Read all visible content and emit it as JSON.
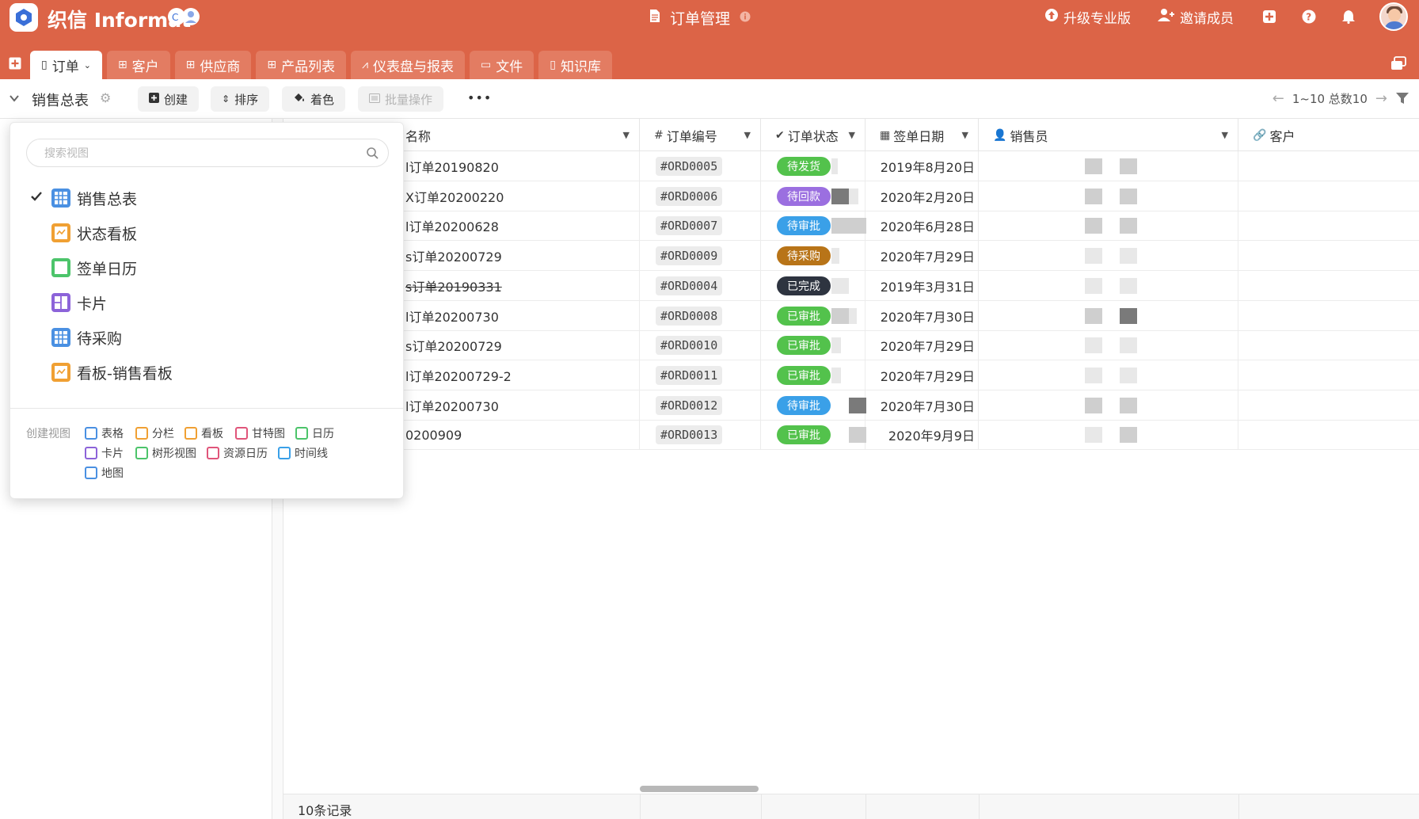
{
  "header": {
    "brand": "织信 Informat",
    "page_title": "订单管理",
    "actions": {
      "upgrade": "升级专业版",
      "invite": "邀请成员"
    }
  },
  "tabs": [
    {
      "label": "订单",
      "icon": "doc-icon"
    },
    {
      "label": "客户",
      "icon": "table-icon"
    },
    {
      "label": "供应商",
      "icon": "table-icon"
    },
    {
      "label": "产品列表",
      "icon": "table-icon"
    },
    {
      "label": "仪表盘与报表",
      "icon": "chart-icon"
    },
    {
      "label": "文件",
      "icon": "folder-icon"
    },
    {
      "label": "知识库",
      "icon": "doc-icon"
    }
  ],
  "toolbar": {
    "view_name": "销售总表",
    "create": "创建",
    "sort": "排序",
    "color": "着色",
    "batch": "批量操作",
    "more": "•••",
    "pager": "1~10 总数10"
  },
  "dropdown": {
    "search_placeholder": "搜索视图",
    "views": [
      {
        "label": "销售总表",
        "icon": "table-view-icon",
        "selected": true
      },
      {
        "label": "状态看板",
        "icon": "kanban-view-icon",
        "selected": false
      },
      {
        "label": "签单日历",
        "icon": "calendar-view-icon",
        "selected": false
      },
      {
        "label": "卡片",
        "icon": "card-view-icon",
        "selected": false
      },
      {
        "label": "待采购",
        "icon": "table-view-icon",
        "selected": false
      },
      {
        "label": "看板-销售看板",
        "icon": "kanban-view-icon",
        "selected": false
      }
    ],
    "create_label": "创建视图",
    "create_types": [
      "表格",
      "分栏",
      "看板",
      "甘特图",
      "日历",
      "卡片",
      "树形视图",
      "资源日历",
      "时间线",
      "地图"
    ]
  },
  "grid": {
    "columns": [
      "名称",
      "订单编号",
      "订单状态",
      "签单日期",
      "销售员",
      "客户"
    ],
    "rows": [
      {
        "name": "订单20190820",
        "name_prefix": "l",
        "code": "#ORD0005",
        "status": "待发货",
        "date": "2019年8月20日"
      },
      {
        "name": "订单20200220",
        "name_prefix": "X",
        "code": "#ORD0006",
        "status": "待回款",
        "date": "2020年2月20日"
      },
      {
        "name": "订单20200628",
        "name_prefix": "l",
        "code": "#ORD0007",
        "status": "待审批",
        "date": "2020年6月28日"
      },
      {
        "name": "订单20200729",
        "name_prefix": "s",
        "code": "#ORD0009",
        "status": "待采购",
        "date": "2020年7月29日"
      },
      {
        "name": "订单20190331",
        "name_prefix": "s",
        "code": "#ORD0004",
        "status": "已完成",
        "date": "2019年3月31日",
        "strike": true
      },
      {
        "name": "订单20200730",
        "name_prefix": "l",
        "code": "#ORD0008",
        "status": "已审批",
        "date": "2020年7月30日"
      },
      {
        "name": "订单20200729",
        "name_prefix": "s",
        "code": "#ORD0010",
        "status": "已审批",
        "date": "2020年7月29日"
      },
      {
        "name": "订单20200729-2",
        "name_prefix": "l",
        "code": "#ORD0011",
        "status": "已审批",
        "date": "2020年7月29日"
      },
      {
        "name": "订单20200730",
        "name_prefix": "l",
        "code": "#ORD0012",
        "status": "待审批",
        "date": "2020年7月30日"
      },
      {
        "name": "0200909",
        "name_prefix": "",
        "code": "#ORD0013",
        "status": "已审批",
        "date": "2020年9月9日"
      }
    ],
    "footer": "10条记录"
  },
  "colors": {
    "header_bg": "#dc6447",
    "status": {
      "待发货": "#53c24c",
      "待回款": "#9b6fe0",
      "待审批": "#3aa0e8",
      "待采购": "#b87418",
      "已完成": "#2e3440",
      "已审批": "#53c24c"
    },
    "view_icons": {
      "table-view-icon": "#4a90e2",
      "kanban-view-icon": "#f0a033",
      "calendar-view-icon": "#4cc46a",
      "card-view-icon": "#8c63d9"
    }
  }
}
